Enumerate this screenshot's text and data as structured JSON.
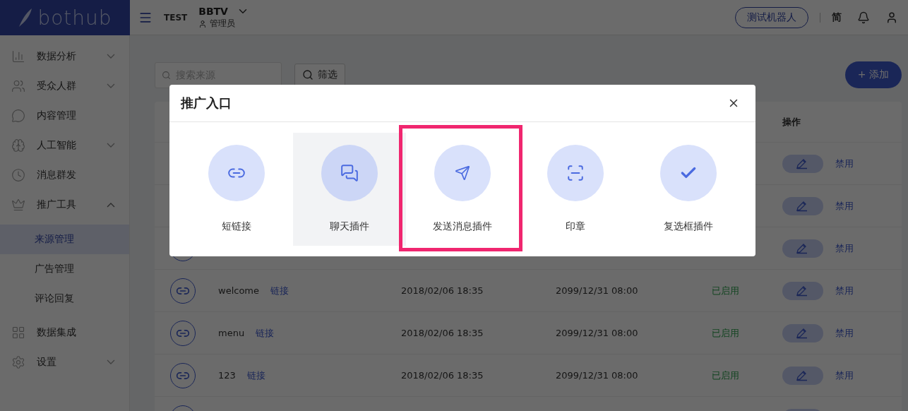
{
  "logo": "bothub",
  "header": {
    "title": "TEST",
    "account": "BBTV",
    "role": "管理员",
    "robot_button": "测试机器人",
    "language": "简"
  },
  "sidebar": {
    "items": [
      {
        "label": "数据分析",
        "kind": "group",
        "expanded": false
      },
      {
        "label": "受众人群",
        "kind": "group",
        "expanded": false
      },
      {
        "label": "内容管理",
        "kind": "link"
      },
      {
        "label": "人工智能",
        "kind": "group",
        "expanded": false
      },
      {
        "label": "消息群发",
        "kind": "link"
      },
      {
        "label": "推广工具",
        "kind": "group",
        "expanded": true,
        "children": [
          {
            "label": "来源管理",
            "selected": true
          },
          {
            "label": "广告管理",
            "selected": false
          },
          {
            "label": "评论回复",
            "selected": false
          }
        ]
      },
      {
        "label": "数据集成",
        "kind": "link"
      },
      {
        "label": "设置",
        "kind": "group",
        "expanded": false
      }
    ]
  },
  "toolbar": {
    "search_placeholder": "搜索来源",
    "filter": "筛选",
    "add": "+ 添加"
  },
  "table": {
    "action_header": "操作",
    "rows": [
      {
        "kind": "covered",
        "action": "禁用"
      },
      {
        "kind": "covered",
        "action": "禁用"
      },
      {
        "kind": "partly",
        "action": "禁用"
      },
      {
        "kind": "full",
        "name": "welcome",
        "link": "链接",
        "created": "2018/02/06 18:35",
        "expires": "2099/12/31 08:00",
        "status": "已启用",
        "action": "禁用"
      },
      {
        "kind": "full",
        "name": "menu",
        "link": "链接",
        "created": "2018/02/06 18:35",
        "expires": "2099/12/31 08:00",
        "status": "已启用",
        "action": "禁用"
      },
      {
        "kind": "full",
        "name": "123",
        "link": "链接",
        "created": "2018/02/06 18:35",
        "expires": "2099/12/31 08:00",
        "status": "已启用",
        "action": "禁用"
      },
      {
        "kind": "cut"
      }
    ]
  },
  "dialog": {
    "title": "推广入口",
    "items": [
      {
        "label": "短链接",
        "hovered": false,
        "highlighted": false
      },
      {
        "label": "聊天插件",
        "hovered": true,
        "highlighted": false
      },
      {
        "label": "发送消息插件",
        "hovered": false,
        "highlighted": true
      },
      {
        "label": "印章",
        "hovered": false,
        "highlighted": false
      },
      {
        "label": "复选框插件",
        "hovered": false,
        "highlighted": false
      }
    ]
  }
}
